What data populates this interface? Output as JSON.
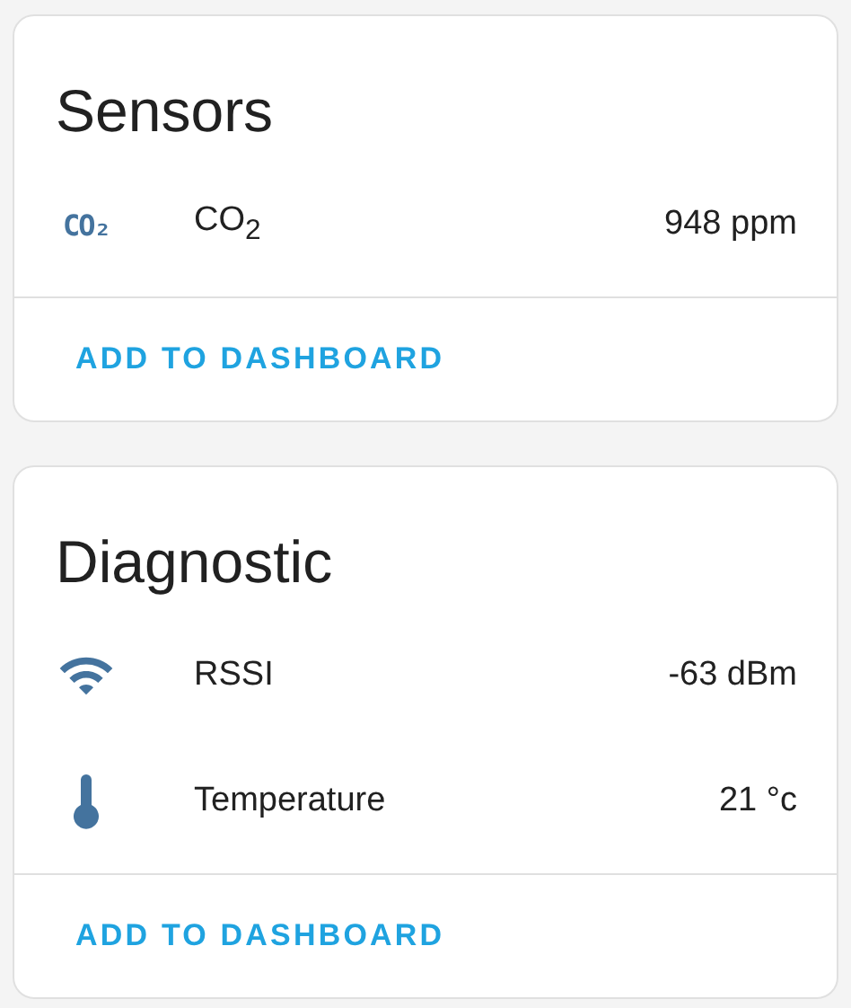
{
  "cards": [
    {
      "title": "Sensors",
      "rows": [
        {
          "kind": "text",
          "icon_text": "CO₂",
          "name": "CO$_{2}$",
          "value": "948 ppm"
        }
      ],
      "action": "ADD TO DASHBOARD"
    },
    {
      "title": "Diagnostic",
      "rows": [
        {
          "kind": "wifi",
          "name": "RSSI",
          "value": "-63 dBm"
        },
        {
          "kind": "thermometer",
          "name": "Temperature",
          "value": "21 °c"
        }
      ],
      "action": "ADD TO DASHBOARD"
    }
  ]
}
